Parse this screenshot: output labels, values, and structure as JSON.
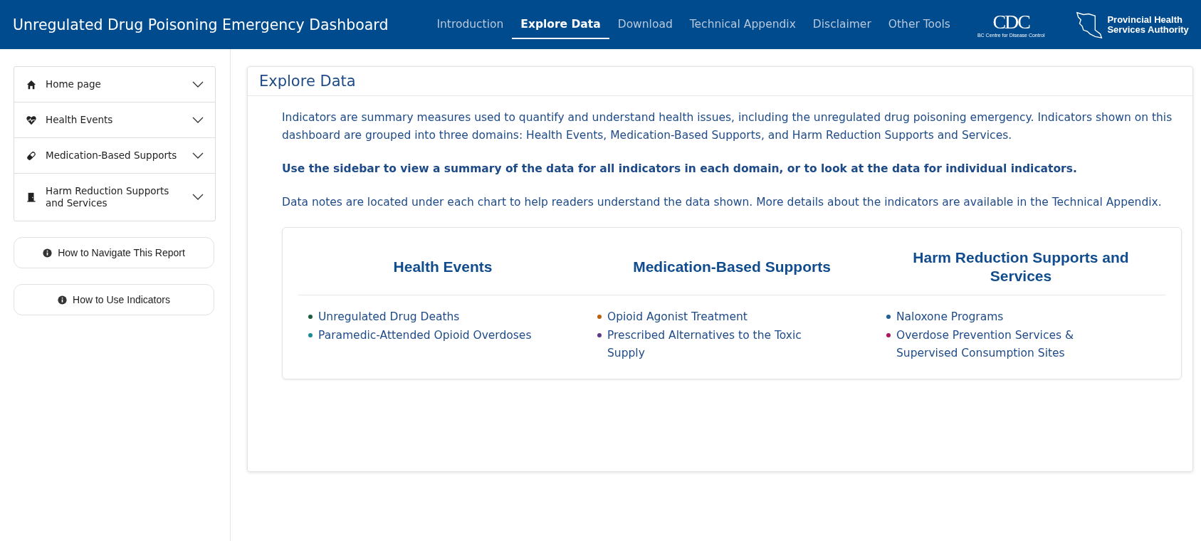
{
  "header": {
    "title": "Unregulated Drug Poisoning Emergency Dashboard",
    "nav": [
      {
        "label": "Introduction",
        "selected": false
      },
      {
        "label": "Explore Data",
        "selected": true
      },
      {
        "label": "Download",
        "selected": false
      },
      {
        "label": "Technical Appendix",
        "selected": false
      },
      {
        "label": "Disclaimer",
        "selected": false
      },
      {
        "label": "Other Tools",
        "selected": false
      }
    ],
    "logos": [
      {
        "kind": "cdc",
        "mark": "CDC",
        "caption": "BC Centre for Disease Control"
      },
      {
        "kind": "phsa",
        "lines": [
          "Provincial Health",
          "Services Authority"
        ]
      }
    ]
  },
  "sidebar": {
    "items": [
      {
        "label": "Home page",
        "kind": "home",
        "expanded": false
      },
      {
        "label": "Health Events",
        "kind": "heart",
        "expanded": false
      },
      {
        "label": "Medication-Based Supports",
        "kind": "pill",
        "expanded": false
      },
      {
        "label": "Harm Reduction Supports and Services",
        "kind": "door",
        "expanded": false
      }
    ],
    "buttons": [
      "How to Navigate This Report",
      "How to Use Indicators"
    ]
  },
  "panel": {
    "title": "Explore Data",
    "paragraphs": [
      {
        "text": "Indicators are summary measures used to quantify and understand health issues, including the unregulated drug poisoning emergency. Indicators shown on this dashboard are grouped into three domains: Health Events, Medication-Based Supports, and Harm Reduction Supports and Services.",
        "bold": false
      },
      {
        "text": "Use the sidebar to view a summary of the data for all indicators in each domain, or to look at the data for individual indicators.",
        "bold": true
      },
      {
        "text": "Data notes are located under each chart to help readers understand the data shown. More details about the indicators are available in the Technical Appendix.",
        "bold": false
      }
    ],
    "domains": [
      {
        "heading": "Health Events",
        "items": [
          {
            "label": "Unregulated Drug Deaths",
            "color": "#1b5e3b"
          },
          {
            "label": "Paramedic-Attended Opioid Overdoses",
            "color": "#1a8a9c"
          }
        ]
      },
      {
        "heading": "Medication-Based Supports",
        "items": [
          {
            "label": "Opioid Agonist Treatment",
            "color": "#b8620f"
          },
          {
            "label": "Prescribed Alternatives to the Toxic Supply",
            "color": "#5c3a8a"
          }
        ]
      },
      {
        "heading": "Harm Reduction Supports and Services",
        "items": [
          {
            "label": "Naloxone Programs",
            "color": "#1d5f96"
          },
          {
            "label": "Overdose Prevention Services & Supervised Consumption Sites",
            "color": "#b0145a"
          }
        ]
      }
    ]
  }
}
